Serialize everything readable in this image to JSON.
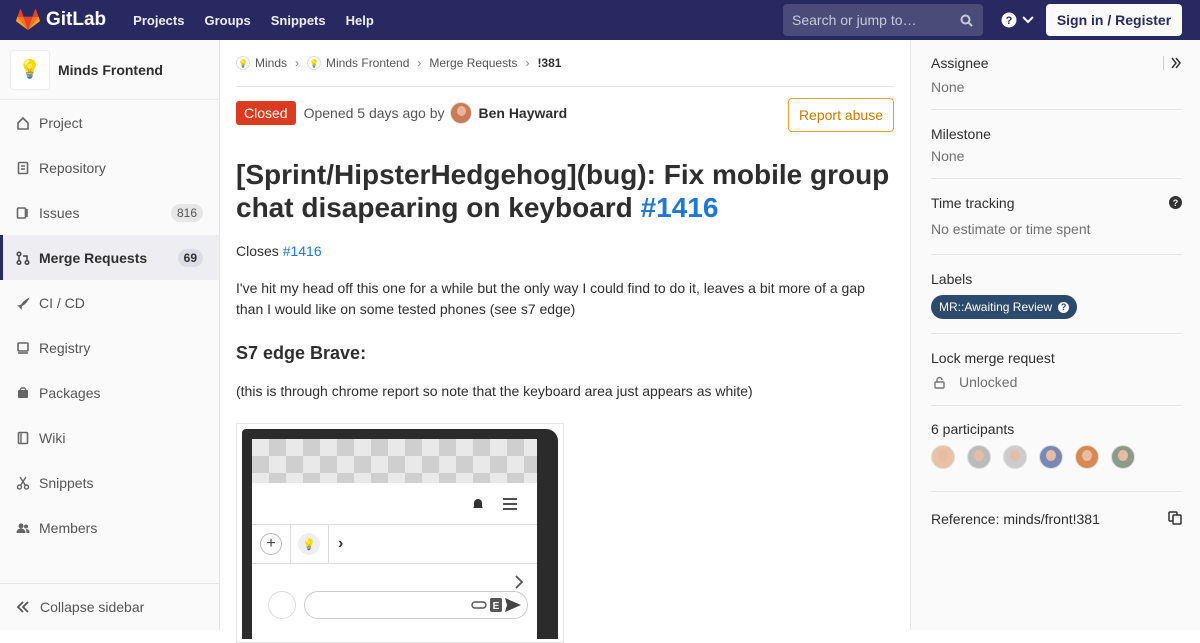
{
  "topbar": {
    "brand": "GitLab",
    "nav": [
      "Projects",
      "Groups",
      "Snippets",
      "Help"
    ],
    "search_placeholder": "Search or jump to…",
    "signin": "Sign in / Register",
    "colors": {
      "bg": "#292961",
      "accent": "#fc6d26"
    }
  },
  "sidebar": {
    "project_name": "Minds Frontend",
    "project_icon": "lightbulb-icon",
    "items": [
      {
        "label": "Project",
        "icon": "home-icon"
      },
      {
        "label": "Repository",
        "icon": "doc-icon"
      },
      {
        "label": "Issues",
        "icon": "issues-icon",
        "count": "816"
      },
      {
        "label": "Merge Requests",
        "icon": "merge-icon",
        "count": "69",
        "active": true
      },
      {
        "label": "CI / CD",
        "icon": "rocket-icon"
      },
      {
        "label": "Registry",
        "icon": "container-icon"
      },
      {
        "label": "Packages",
        "icon": "package-icon"
      },
      {
        "label": "Wiki",
        "icon": "book-icon"
      },
      {
        "label": "Snippets",
        "icon": "scissors-icon"
      },
      {
        "label": "Members",
        "icon": "users-icon"
      }
    ],
    "collapse": "Collapse sidebar"
  },
  "breadcrumb": [
    "Minds",
    "Minds Frontend",
    "Merge Requests",
    "!381"
  ],
  "mr": {
    "status": "Closed",
    "opened": "Opened 5 days ago by",
    "author": "Ben Hayward",
    "report": "Report abuse",
    "title": "[Sprint/HipsterHedgehog](bug): Fix mobile group chat disapearing on keyboard",
    "title_ref": "#1416",
    "closes_prefix": "Closes",
    "closes_ref": "#1416",
    "description": "I've hit my head off this one for a while but the only way I could find to do it, leaves a bit more of a gap than I would like on some tested phones (see s7 edge)",
    "heading": "S7 edge Brave:",
    "note": "(this is through chrome report so note that the keyboard area just appears as white)"
  },
  "aside": {
    "assignee_label": "Assignee",
    "assignee_value": "None",
    "milestone_label": "Milestone",
    "milestone_value": "None",
    "time_label": "Time tracking",
    "time_value": "No estimate or time spent",
    "labels_label": "Labels",
    "label_chip": "MR::Awaiting Review",
    "label_color": "#2c4a6b",
    "lock_label": "Lock merge request",
    "lock_value": "Unlocked",
    "participants_label": "6 participants",
    "participants": [
      "#e9c2a6",
      "#bbbbbb",
      "#cccccc",
      "#7a88b8",
      "#d9894f",
      "#8c9a88"
    ],
    "reference": "Reference: minds/front!381"
  }
}
